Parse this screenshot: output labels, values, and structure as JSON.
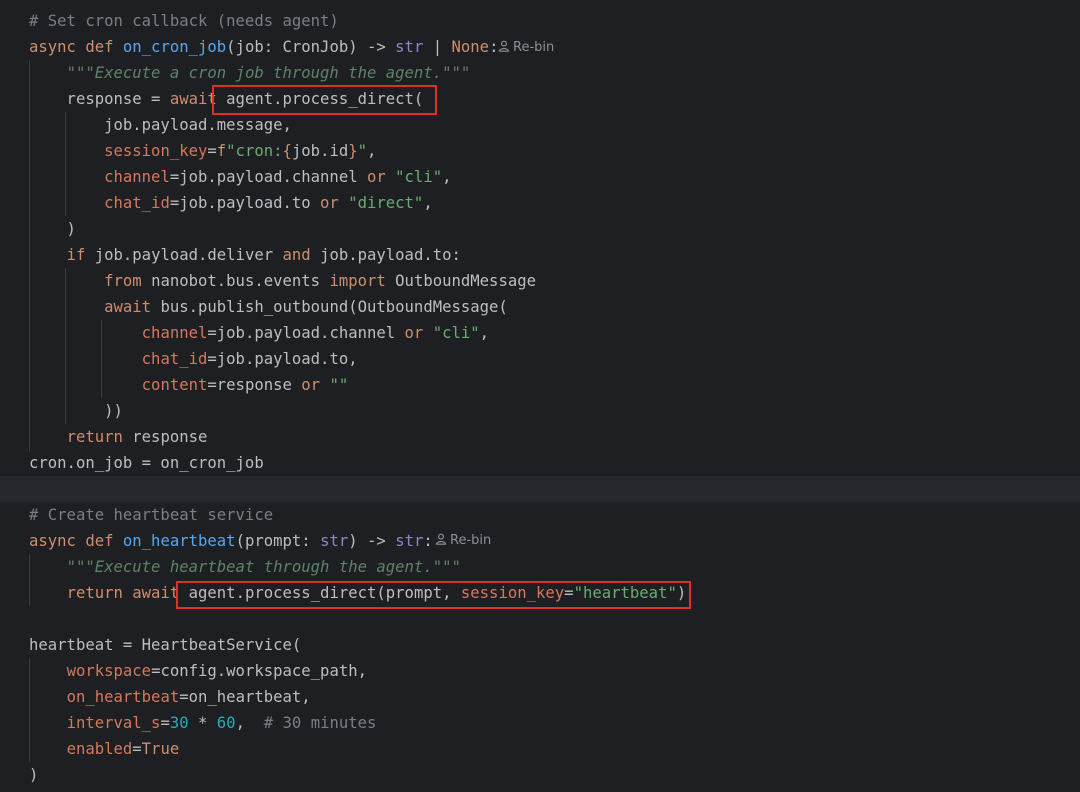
{
  "editor": {
    "language": "python",
    "hints": {
      "rebin_1": "Re-bin",
      "rebin_2": "Re-bin"
    },
    "highlight_color": "#e0302a",
    "lines": [
      {
        "n": 1,
        "tokens": [
          [
            "cm",
            "# Set cron callback (needs agent)"
          ]
        ]
      },
      {
        "n": 2,
        "tokens": [
          [
            "kw",
            "async def "
          ],
          [
            "fn",
            "on_cron_job"
          ],
          [
            "",
            "(job: CronJob) -> "
          ],
          [
            "bi",
            "str"
          ],
          [
            "",
            " | "
          ],
          [
            "kw",
            "None"
          ],
          [
            "",
            ":"
          ]
        ]
      },
      {
        "n": 3,
        "tokens": [
          [
            "",
            "    "
          ],
          [
            "doc",
            "\"\"\"Execute a cron job through the agent.\"\"\""
          ]
        ]
      },
      {
        "n": 4,
        "tokens": [
          [
            "",
            "    response = "
          ],
          [
            "kw",
            "await "
          ],
          [
            "",
            "agent.process_direct("
          ]
        ]
      },
      {
        "n": 5,
        "tokens": [
          [
            "",
            "        job.payload.message,"
          ]
        ]
      },
      {
        "n": 6,
        "tokens": [
          [
            "",
            "        "
          ],
          [
            "kwarg",
            "session_key"
          ],
          [
            "",
            "="
          ],
          [
            "fs",
            "f"
          ],
          [
            "str",
            "\"cron:"
          ],
          [
            "fs",
            "{"
          ],
          [
            "",
            "job.id"
          ],
          [
            "fs",
            "}"
          ],
          [
            "str",
            "\""
          ],
          [
            "",
            ","
          ]
        ]
      },
      {
        "n": 7,
        "tokens": [
          [
            "",
            "        "
          ],
          [
            "kwarg",
            "channel"
          ],
          [
            "",
            "=job.payload.channel "
          ],
          [
            "kw",
            "or "
          ],
          [
            "str",
            "\"cli\""
          ],
          [
            "",
            ","
          ]
        ]
      },
      {
        "n": 8,
        "tokens": [
          [
            "",
            "        "
          ],
          [
            "kwarg",
            "chat_id"
          ],
          [
            "",
            "=job.payload.to "
          ],
          [
            "kw",
            "or "
          ],
          [
            "str",
            "\"direct\""
          ],
          [
            "",
            ","
          ]
        ]
      },
      {
        "n": 9,
        "tokens": [
          [
            "",
            "    )"
          ]
        ]
      },
      {
        "n": 10,
        "tokens": [
          [
            "",
            "    "
          ],
          [
            "kw",
            "if "
          ],
          [
            "",
            "job.payload.deliver "
          ],
          [
            "kw",
            "and "
          ],
          [
            "",
            "job.payload.to:"
          ]
        ]
      },
      {
        "n": 11,
        "tokens": [
          [
            "",
            "        "
          ],
          [
            "kw",
            "from "
          ],
          [
            "",
            "nanobot.bus.events "
          ],
          [
            "kw",
            "import "
          ],
          [
            "",
            "OutboundMessage"
          ]
        ]
      },
      {
        "n": 12,
        "tokens": [
          [
            "",
            "        "
          ],
          [
            "kw",
            "await "
          ],
          [
            "",
            "bus.publish_outbound(OutboundMessage("
          ]
        ]
      },
      {
        "n": 13,
        "tokens": [
          [
            "",
            "            "
          ],
          [
            "kwarg",
            "channel"
          ],
          [
            "",
            "=job.payload.channel "
          ],
          [
            "kw",
            "or "
          ],
          [
            "str",
            "\"cli\""
          ],
          [
            "",
            ","
          ]
        ]
      },
      {
        "n": 14,
        "tokens": [
          [
            "",
            "            "
          ],
          [
            "kwarg",
            "chat_id"
          ],
          [
            "",
            "=job.payload.to,"
          ]
        ]
      },
      {
        "n": 15,
        "tokens": [
          [
            "",
            "            "
          ],
          [
            "kwarg",
            "content"
          ],
          [
            "",
            "=response "
          ],
          [
            "kw",
            "or "
          ],
          [
            "str",
            "\"\""
          ]
        ]
      },
      {
        "n": 16,
        "tokens": [
          [
            "",
            "        ))"
          ]
        ]
      },
      {
        "n": 17,
        "tokens": [
          [
            "",
            "    "
          ],
          [
            "kw",
            "return "
          ],
          [
            "",
            "response"
          ]
        ]
      },
      {
        "n": 18,
        "tokens": [
          [
            "",
            "cron.on_job = on_cron_job"
          ]
        ]
      },
      {
        "n": 19,
        "tokens": []
      },
      {
        "n": 20,
        "tokens": [
          [
            "cm",
            "# Create heartbeat service"
          ]
        ]
      },
      {
        "n": 21,
        "tokens": [
          [
            "kw",
            "async def "
          ],
          [
            "fn",
            "on_heartbeat"
          ],
          [
            "",
            "(prompt: "
          ],
          [
            "bi",
            "str"
          ],
          [
            "",
            ") -> "
          ],
          [
            "bi",
            "str"
          ],
          [
            "",
            ":"
          ]
        ]
      },
      {
        "n": 22,
        "tokens": [
          [
            "",
            "    "
          ],
          [
            "doc",
            "\"\"\"Execute heartbeat through the agent.\"\"\""
          ]
        ]
      },
      {
        "n": 23,
        "tokens": [
          [
            "",
            "    "
          ],
          [
            "kw",
            "return await "
          ],
          [
            "",
            "agent.process_direct(prompt, "
          ],
          [
            "kwarg",
            "session_key"
          ],
          [
            "",
            "="
          ],
          [
            "str",
            "\"heartbeat\""
          ],
          [
            "",
            ")"
          ]
        ]
      },
      {
        "n": 24,
        "tokens": []
      },
      {
        "n": 25,
        "tokens": [
          [
            "",
            "heartbeat = HeartbeatService("
          ]
        ]
      },
      {
        "n": 26,
        "tokens": [
          [
            "",
            "    "
          ],
          [
            "kwarg",
            "workspace"
          ],
          [
            "",
            "=config.workspace_path,"
          ]
        ]
      },
      {
        "n": 27,
        "tokens": [
          [
            "",
            "    "
          ],
          [
            "kwarg",
            "on_heartbeat"
          ],
          [
            "",
            "=on_heartbeat,"
          ]
        ]
      },
      {
        "n": 28,
        "tokens": [
          [
            "",
            "    "
          ],
          [
            "kwarg",
            "interval_s"
          ],
          [
            "",
            "="
          ],
          [
            "num",
            "30"
          ],
          [
            "",
            " * "
          ],
          [
            "num",
            "60"
          ],
          [
            "",
            ",  "
          ],
          [
            "cm",
            "# 30 minutes"
          ]
        ]
      },
      {
        "n": 29,
        "tokens": [
          [
            "",
            "    "
          ],
          [
            "kwarg",
            "enabled"
          ],
          [
            "",
            "="
          ],
          [
            "kw",
            "True"
          ]
        ]
      },
      {
        "n": 30,
        "tokens": [
          [
            "",
            ")"
          ]
        ]
      }
    ]
  }
}
